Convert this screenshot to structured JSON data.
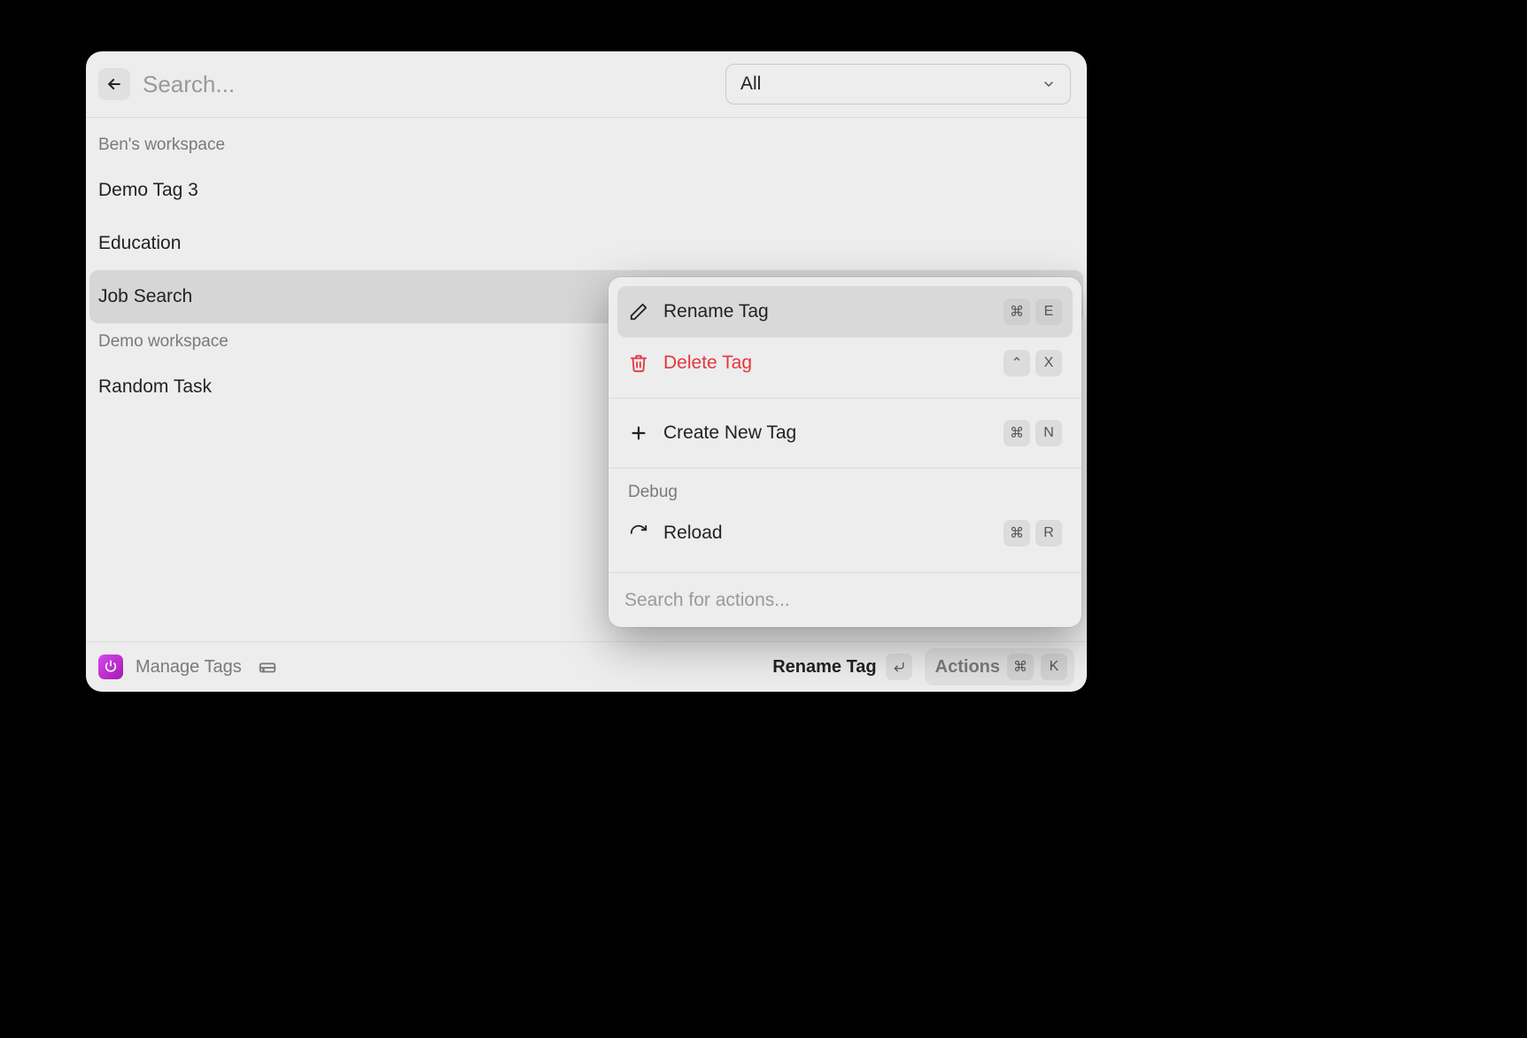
{
  "header": {
    "search_placeholder": "Search...",
    "dropdown_value": "All"
  },
  "sections": [
    {
      "title": "Ben's workspace",
      "items": [
        {
          "label": "Demo Tag 3",
          "selected": false
        },
        {
          "label": "Education",
          "selected": false
        },
        {
          "label": "Job Search",
          "selected": true
        }
      ]
    },
    {
      "title": "Demo workspace",
      "items": [
        {
          "label": "Random Task",
          "selected": false
        }
      ]
    }
  ],
  "context_menu": {
    "groups": [
      {
        "items": [
          {
            "icon": "pencil",
            "label": "Rename Tag",
            "shortcut": [
              "⌘",
              "E"
            ],
            "selected": true
          },
          {
            "icon": "trash",
            "label": "Delete Tag",
            "shortcut": [
              "⌃",
              "X"
            ],
            "danger": true
          }
        ]
      },
      {
        "items": [
          {
            "icon": "plus",
            "label": "Create New Tag",
            "shortcut": [
              "⌘",
              "N"
            ]
          }
        ]
      },
      {
        "title": "Debug",
        "items": [
          {
            "icon": "reload",
            "label": "Reload",
            "shortcut": [
              "⌘",
              "R"
            ]
          }
        ]
      }
    ],
    "search_placeholder": "Search for actions..."
  },
  "footer": {
    "title": "Manage Tags",
    "primary_action_label": "Rename Tag",
    "actions_label": "Actions",
    "actions_shortcut": [
      "⌘",
      "K"
    ]
  }
}
